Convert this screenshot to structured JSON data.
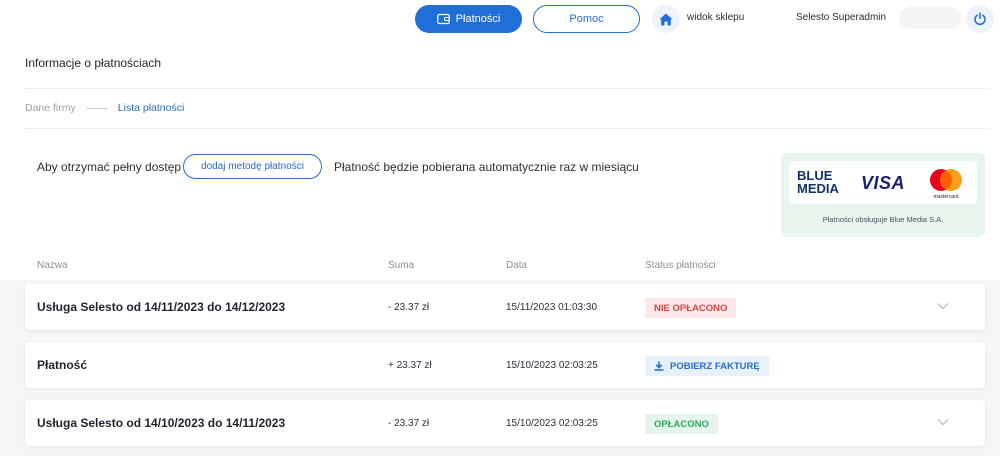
{
  "topbar": {
    "payments_label": "Płatności",
    "help_label": "Pomoc",
    "shop_view_label": "widok sklepu",
    "user_name": "Selesto Superadmin"
  },
  "page": {
    "title": "Informacje o płatnościach",
    "steps": [
      "Dane firmy",
      "Lista płatności"
    ]
  },
  "notice": {
    "access_text": "Aby otrzymać pełny dostęp",
    "add_method_label": "dodaj metodę płatności",
    "auto_text": "Płatność będzie pobierana automatycznie raz w miesiącu"
  },
  "bluemedia": {
    "logo_line1": "BLUE",
    "logo_line2": "MEDIA",
    "visa": "VISA",
    "mastercard": "mastercard",
    "caption": "Płatności obsługuje Blue Media S.A."
  },
  "table": {
    "headers": [
      "Nazwa",
      "Suma",
      "Data",
      "Status płatności"
    ],
    "rows": [
      {
        "name": "Usługa Selesto od 14/11/2023 do 14/12/2023",
        "sum": "- 23.37 zł",
        "date": "15/11/2023 01:03:30",
        "status": "NIE OPŁACONO"
      },
      {
        "name": "Płatność",
        "sum": "+ 23.37 zł",
        "date": "15/10/2023 02:03:25",
        "status": "POBIERZ FAKTURĘ"
      },
      {
        "name": "Usługa Selesto od 14/10/2023 do 14/11/2023",
        "sum": "- 23.37 zł",
        "date": "15/10/2023 02:03:25",
        "status": "OPŁACONO"
      }
    ]
  },
  "colors": {
    "primary": "#1f6fd6",
    "unpaid": "#d64545",
    "paid": "#2fa85a",
    "bluemedia_bg": "#e7f5ec"
  }
}
